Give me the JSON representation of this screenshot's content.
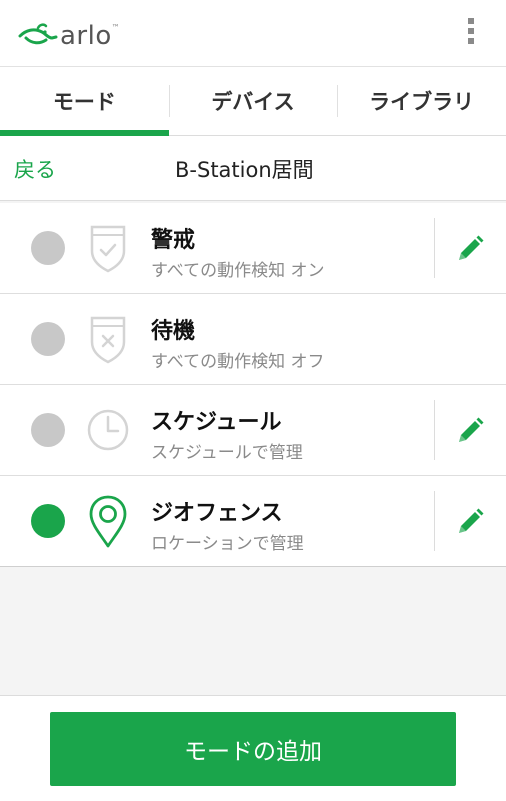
{
  "header": {
    "logo_text": "arlo",
    "logo_tm": "™",
    "menu_icon": "kebab-menu-icon"
  },
  "tabs": [
    {
      "label": "モード",
      "active": true
    },
    {
      "label": "デバイス",
      "active": false
    },
    {
      "label": "ライブラリ",
      "active": false
    }
  ],
  "subheader": {
    "back_label": "戻る",
    "station_name": "B-Station居間"
  },
  "modes": [
    {
      "title": "警戒",
      "desc": "すべての動作検知 オン",
      "selected": false,
      "icon": "shield-check-icon",
      "editable": true
    },
    {
      "title": "待機",
      "desc": "すべての動作検知 オフ",
      "selected": false,
      "icon": "shield-x-icon",
      "editable": false
    },
    {
      "title": "スケジュール",
      "desc": "スケジュールで管理",
      "selected": false,
      "icon": "clock-icon",
      "editable": true
    },
    {
      "title": "ジオフェンス",
      "desc": "ロケーションで管理",
      "selected": true,
      "icon": "location-pin-icon",
      "editable": true
    }
  ],
  "footer": {
    "add_button_label": "モードの追加"
  },
  "colors": {
    "accent": "#1aa54b",
    "inactive_radio": "#c8c8c8",
    "inactive_icon": "#cfcfcf"
  }
}
